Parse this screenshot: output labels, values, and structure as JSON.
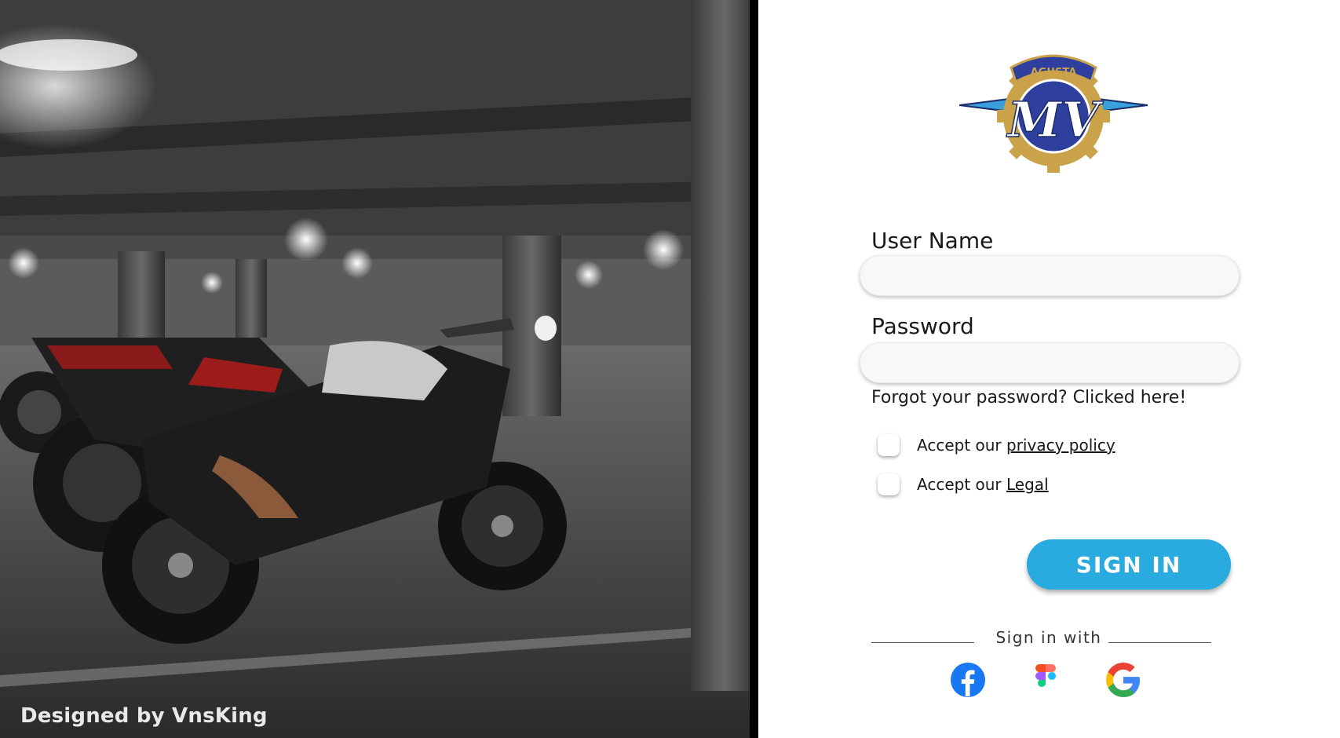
{
  "hero": {
    "credit": "Designed by VnsKing"
  },
  "logo": {
    "banner_text": "AGUSTA",
    "monogram": "MV"
  },
  "form": {
    "username_label": "User Name",
    "username_value": "",
    "password_label": "Password",
    "password_value": "",
    "forgot_text": "Forgot your password? Clicked here!",
    "privacy_prefix": "Accept our ",
    "privacy_link": "privacy policy",
    "legal_prefix": "Accept our ",
    "legal_link": "Legal",
    "signin_label": "SIGN IN"
  },
  "social": {
    "divider_text": "Sign in with",
    "providers": [
      {
        "name": "facebook-icon",
        "color": "#1877f2"
      },
      {
        "name": "figma-icon",
        "color": "#a259ff"
      },
      {
        "name": "google-icon",
        "color": "#4285f4"
      }
    ]
  }
}
